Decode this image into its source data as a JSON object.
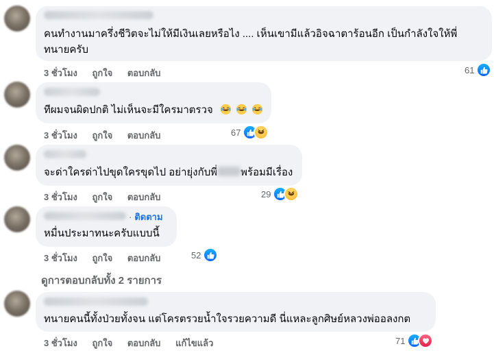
{
  "comments": [
    {
      "text_line1": "คนทำงานมาครึ่งชีวิตจะไม่ให้มีเงินเลยหรือไง .... เห็นเขามีแล้วอิจฉาตาร้อนอีก เป็นกำลังใจให้พี่",
      "text_line2": "ทนายครับ",
      "time": "3 ชั่วโมง",
      "like_label": "ถูกใจ",
      "reply_label": "ตอบกลับ",
      "reaction_count": "61",
      "reactions": [
        "like"
      ]
    },
    {
      "text": "ทีผมจนผิดปกติ ไม่เห็นจะมีใครมาตรวจ",
      "inline_emoji": [
        "laughing-tears-emoji",
        "laughing-tears-emoji",
        "laughing-tears-emoji"
      ],
      "time": "3 ชั่วโมง",
      "like_label": "ถูกใจ",
      "reply_label": "ตอบกลับ",
      "reaction_count": "67",
      "reactions": [
        "like",
        "haha"
      ]
    },
    {
      "text_before": "จะด่าใครด่าไปขุดใครขุดไป อย่ายุ่งกับพี่",
      "text_after": "พร้อมมีเรื่อง",
      "time": "3 ชั่วโมง",
      "like_label": "ถูกใจ",
      "reply_label": "ตอบกลับ",
      "reaction_count": "29",
      "reactions": [
        "like",
        "haha"
      ]
    },
    {
      "follow_label": "ติดตาม",
      "text": "หมื่นประมาทนะครับแบบนี้",
      "time": "3 ชั่วโมง",
      "like_label": "ถูกใจ",
      "reply_label": "ตอบกลับ",
      "reaction_count": "52",
      "reactions": [
        "like"
      ]
    },
    {
      "text": "ทนายคนนี้ทั้งป่วยทั้งจน แต่โครตรวยน้ำใจรวยความดี นี่แหละลูกศิษย์หลวงพ่ออลงกต",
      "time": "3 ชั่วโมง",
      "like_label": "ถูกใจ",
      "reply_label": "ตอบกลับ",
      "edited_label": "แก้ไขแล้ว",
      "reaction_count": "71",
      "reactions": [
        "like",
        "love"
      ]
    }
  ],
  "view_replies": "ดูการตอบกลับทั้ง 2 รายการ",
  "colors": {
    "bubble": "#f0f2f5",
    "text": "#050505",
    "secondary": "#65676b",
    "link": "#1b74e4",
    "like": "#0866ff",
    "love": "#e61e4d",
    "haha": "#f7b125"
  }
}
